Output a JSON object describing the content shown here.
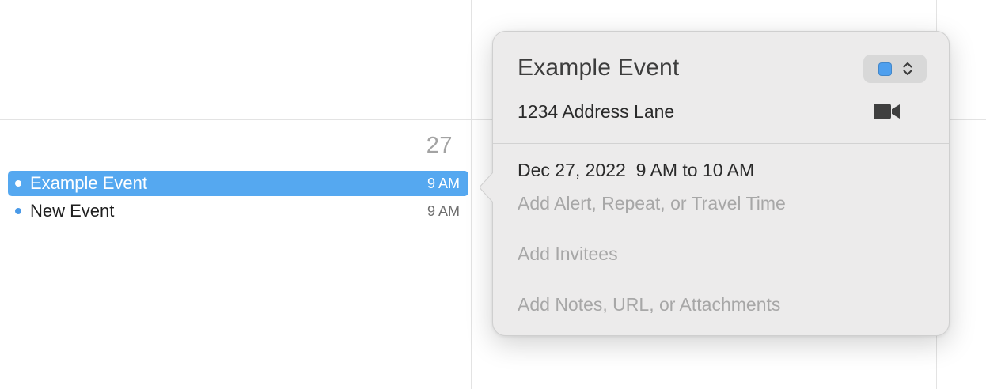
{
  "calendar": {
    "day_number": "27",
    "events": [
      {
        "title": "Example Event",
        "time": "9 AM",
        "selected": true
      },
      {
        "title": "New Event",
        "time": "9 AM",
        "selected": false
      }
    ]
  },
  "popover": {
    "title": "Example Event",
    "calendar_color": "#4e9fee",
    "location": "1234 Address Lane",
    "video_icon": "video-camera-icon",
    "date_time": "Dec 27, 2022  9 AM to 10 AM",
    "alert_placeholder": "Add Alert, Repeat, or Travel Time",
    "invitees_placeholder": "Add Invitees",
    "notes_placeholder": "Add Notes, URL, or Attachments"
  },
  "colors": {
    "selected_event_bg": "#55a8f0",
    "event_dot": "#4a9ae8",
    "popover_bg": "#ecebeb"
  }
}
